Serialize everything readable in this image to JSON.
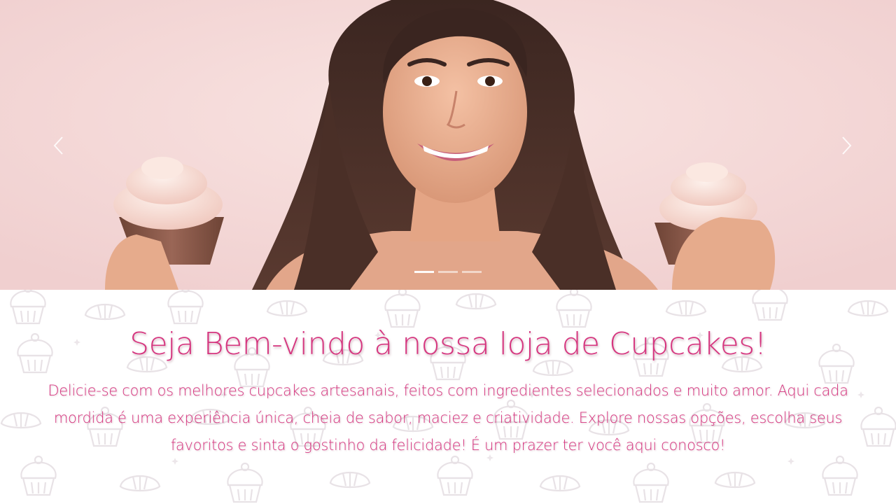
{
  "carousel": {
    "active_slide": 1,
    "slide_count": 3,
    "icons": {
      "prev": "chevron-left-icon",
      "next": "chevron-right-icon"
    },
    "background_color": "#f3d6d6"
  },
  "welcome": {
    "title": "Seja Bem-vindo à nossa loja de Cupcakes!",
    "paragraph": "Delicie-se com os melhores cupcakes artesanais, feitos com ingredientes selecionados e muito amor. Aqui cada mordida é uma experiência única, cheia de sabor, maciez e criatividade. Explore nossas opções, escolha seus favoritos e sinta o gostinho da felicidade! É um prazer ter você aqui conosco!",
    "text_color": "#d6357f"
  }
}
